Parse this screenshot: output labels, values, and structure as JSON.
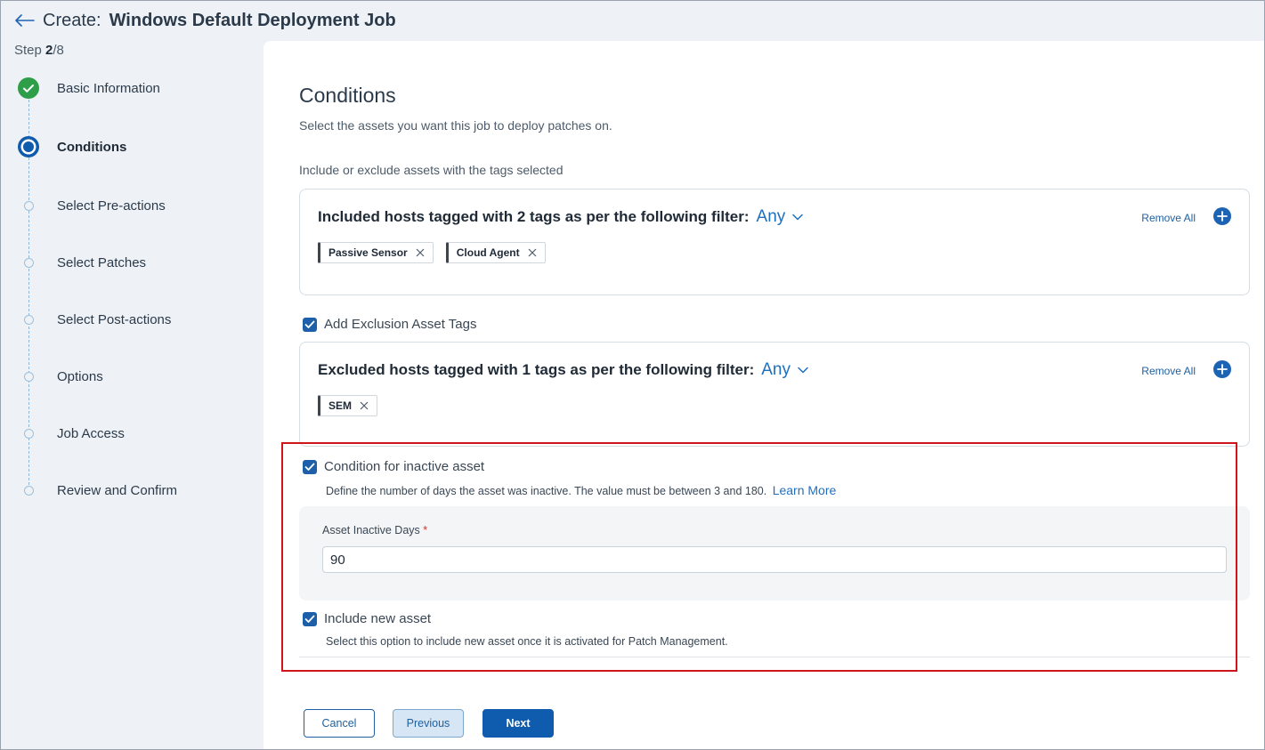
{
  "header": {
    "prefix": "Create:",
    "title": "Windows Default Deployment Job"
  },
  "stepper": {
    "counter_label": "Step",
    "current": "2",
    "separator": "/",
    "total": "8",
    "steps": [
      {
        "label": "Basic Information",
        "state": "complete"
      },
      {
        "label": "Conditions",
        "state": "active"
      },
      {
        "label": "Select Pre-actions",
        "state": "pending"
      },
      {
        "label": "Select Patches",
        "state": "pending"
      },
      {
        "label": "Select Post-actions",
        "state": "pending"
      },
      {
        "label": "Options",
        "state": "pending"
      },
      {
        "label": "Job Access",
        "state": "pending"
      },
      {
        "label": "Review and Confirm",
        "state": "pending"
      }
    ]
  },
  "main": {
    "title": "Conditions",
    "subtitle": "Select the assets you want this job to deploy patches on.",
    "tags_caption": "Include or exclude assets with the tags selected",
    "included": {
      "heading": "Included hosts tagged with 2 tags as per the following filter:",
      "filter_value": "Any",
      "remove_all": "Remove All",
      "tags": [
        "Passive Sensor",
        "Cloud Agent"
      ]
    },
    "exclusion_checkbox": {
      "label": "Add Exclusion Asset Tags",
      "checked": true
    },
    "excluded": {
      "heading": "Excluded hosts tagged with 1 tags as per the following filter:",
      "filter_value": "Any",
      "remove_all": "Remove All",
      "tags": [
        "SEM"
      ]
    },
    "inactive": {
      "checkbox_label": "Condition for inactive asset",
      "checked": true,
      "helper": "Define the number of days the asset was inactive. The value must be between 3 and 180.",
      "learn_more": "Learn More",
      "field_label": "Asset Inactive Days",
      "required_mark": "*",
      "value": "90"
    },
    "new_asset": {
      "checkbox_label": "Include new asset",
      "checked": true,
      "helper": "Select this option to include new asset once it is activated for Patch Management."
    }
  },
  "footer": {
    "cancel": "Cancel",
    "previous": "Previous",
    "next": "Next"
  },
  "colors": {
    "accent": "#0f5bad",
    "complete": "#2e9e48",
    "highlight": "#d0141c",
    "link": "#1f6fbf"
  }
}
